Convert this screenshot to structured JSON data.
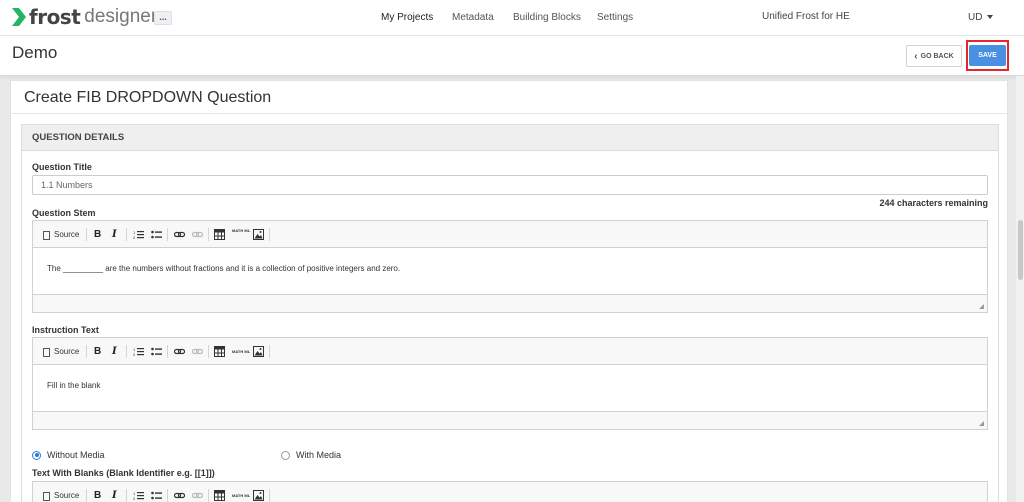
{
  "brand": {
    "name_bold": "frost",
    "name_light": "designer",
    "accent": "#24b463"
  },
  "nav": {
    "more_label": "...",
    "items": [
      "My Projects",
      "Metadata",
      "Building Blocks",
      "Settings"
    ],
    "active": "My Projects",
    "tenant": "Unified Frost for HE",
    "user": "UD"
  },
  "header": {
    "title": "Demo",
    "go_back_label": "GO BACK",
    "save_label": "SAVE",
    "save_color": "#4a90e2",
    "highlight_color": "#e0282e"
  },
  "card": {
    "title": "Create FIB DROPDOWN Question"
  },
  "section": {
    "title": "QUESTION DETAILS"
  },
  "question_title": {
    "label": "Question Title",
    "value": "1.1 Numbers",
    "remaining": "244 characters remaining"
  },
  "toolbar": {
    "source_label": "Source",
    "bold": "B",
    "italic": "I",
    "mathml_label": "MATH ML"
  },
  "question_stem": {
    "label": "Question Stem",
    "content": "The _________ are the numbers without fractions and it is a collection of positive integers and zero."
  },
  "instruction": {
    "label": "Instruction Text",
    "content": "Fill in the blank"
  },
  "media": {
    "option_without": "Without Media",
    "option_with": "With Media",
    "selected": "Without Media"
  },
  "blanks": {
    "label": "Text With Blanks (Blank Identifier e.g. [[1]])"
  }
}
